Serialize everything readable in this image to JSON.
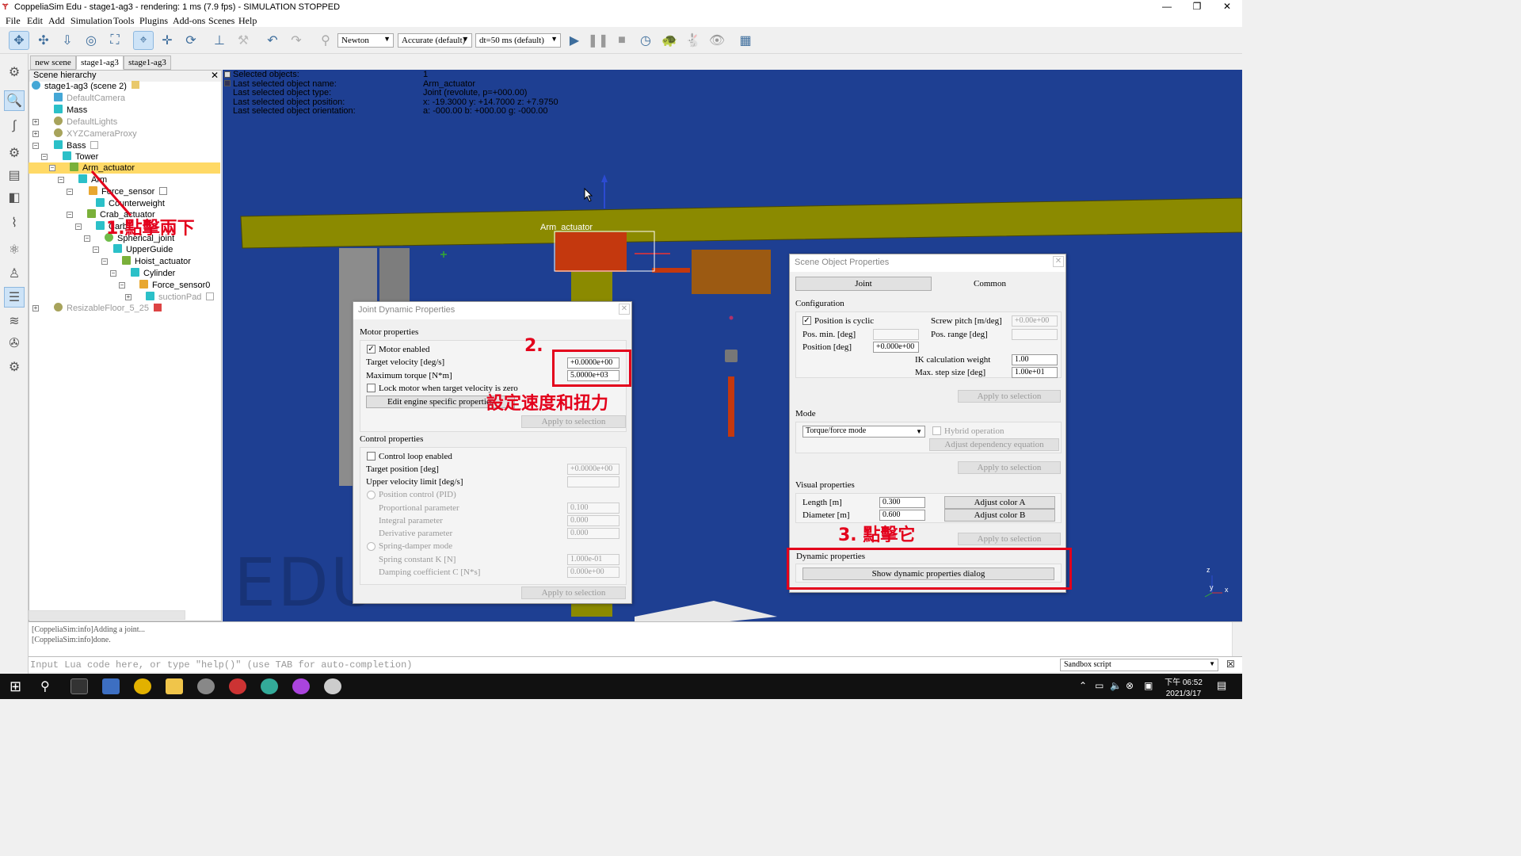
{
  "window": {
    "title": "CoppeliaSim Edu - stage1-ag3 - rendering: 1 ms (7.9 fps) - SIMULATION STOPPED"
  },
  "menu": [
    "File",
    "Edit",
    "Add",
    "Simulation",
    "Tools",
    "Plugins",
    "Add-ons",
    "Scenes",
    "Help"
  ],
  "toolbar": {
    "engine": "Newton",
    "accuracy": "Accurate (default)",
    "timestep": "dt=50 ms (default)"
  },
  "scene_tabs": [
    "new scene",
    "stage1-ag3",
    "stage1-ag3"
  ],
  "hierarchy": {
    "title": "Scene hierarchy",
    "items": [
      "stage1-ag3 (scene 2)",
      "DefaultCamera",
      "Mass",
      "DefaultLights",
      "XYZCameraProxy",
      "Bass",
      "Tower",
      "Arm_actuator",
      "Arm",
      "Force_sensor",
      "Counterweight",
      "Crab_actuator",
      "Carb",
      "Spherical_joint",
      "UpperGuide",
      "Hoist_actuator",
      "Cylinder",
      "Force_sensor0",
      "suctionPad",
      "ResizableFloor_5_25"
    ]
  },
  "selection_info": {
    "labels": [
      "Selected objects:",
      "Last selected object name:",
      "Last selected object type:",
      "Last selected object position:",
      "Last selected object orientation:"
    ],
    "values": [
      "1",
      "Arm_actuator",
      "Joint (revolute, p=+000.00)",
      "x: -19.3000    y: +14.7000    z: +7.9750",
      "a: -000.00    b: +000.00    g: -000.00"
    ]
  },
  "viewport": {
    "object_label": "Arm_actuator",
    "watermark": "EDU",
    "axes": [
      "z",
      "y",
      "x"
    ]
  },
  "joint_dyn": {
    "title": "Joint Dynamic Properties",
    "motor_section": "Motor properties",
    "motor_enabled": "Motor enabled",
    "target_velocity_label": "Target velocity [deg/s]",
    "target_velocity": "+0.0000e+00",
    "max_torque_label": "Maximum torque [N*m]",
    "max_torque": "5.0000e+03",
    "lock_motor": "Lock motor when target velocity is zero",
    "edit_engine": "Edit engine specific properties",
    "apply": "Apply to selection",
    "control_section": "Control properties",
    "control_loop": "Control loop enabled",
    "target_position_label": "Target position [deg]",
    "target_position": "+0.0000e+00",
    "upper_vel_label": "Upper velocity limit [deg/s]",
    "pid": "Position control (PID)",
    "prop_label": "Proportional parameter",
    "prop": "0.100",
    "int_label": "Integral parameter",
    "int": "0.000",
    "deriv_label": "Derivative parameter",
    "deriv": "0.000",
    "spring": "Spring-damper mode",
    "spring_k_label": "Spring constant K [N]",
    "spring_k": "1.000e-01",
    "damp_label": "Damping coefficient C [N*s]",
    "damp": "0.000e+00"
  },
  "obj_props": {
    "title": "Scene Object Properties",
    "tab_joint": "Joint",
    "tab_common": "Common",
    "config": "Configuration",
    "cyclic": "Position is cyclic",
    "screw_label": "Screw pitch [m/deg]",
    "screw": "+0.00e+00",
    "posmin_label": "Pos. min. [deg]",
    "posrange_label": "Pos. range [deg]",
    "position_label": "Position [deg]",
    "position": "+0.000e+00",
    "ikw_label": "IK calculation weight",
    "ikw": "1.00",
    "maxstep_label": "Max. step size [deg]",
    "maxstep": "1.00e+01",
    "apply": "Apply to selection",
    "mode": "Mode",
    "mode_value": "Torque/force mode",
    "hybrid": "Hybrid operation",
    "adjust_dep": "Adjust dependency equation",
    "visual": "Visual properties",
    "length_label": "Length [m]",
    "length": "0.300",
    "diameter_label": "Diameter [m]",
    "diameter": "0.600",
    "color_a": "Adjust color A",
    "color_b": "Adjust color B",
    "dynamic": "Dynamic properties",
    "show_dyn": "Show dynamic properties dialog"
  },
  "annotations": {
    "step1": "1.點擊兩下",
    "step2": "2.",
    "step2b": "設定速度和扭力",
    "step3": "3. 點擊它"
  },
  "console": {
    "lines": [
      "[CoppeliaSim:info]Adding a joint...",
      "[CoppeliaSim:info]done."
    ],
    "input_placeholder": "Input Lua code here, or type \"help()\" (use TAB for auto-completion)",
    "script_type": "Sandbox script"
  },
  "taskbar": {
    "time": "下午 06:52",
    "date": "2021/3/17"
  },
  "colors": {
    "viewport_bg": "#1e3f92",
    "beam": "#8b8a00",
    "actuator": "#c4380e",
    "annotation": "#e3001b",
    "selection": "#ffd966"
  }
}
